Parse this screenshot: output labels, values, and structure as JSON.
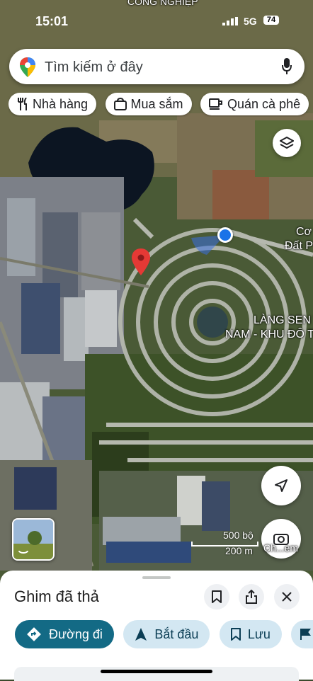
{
  "status_bar": {
    "time": "15:01",
    "network": "5G",
    "battery": "74",
    "top_label": "CÔNG NGHIỆP"
  },
  "search": {
    "placeholder": "Tìm kiếm ở đây"
  },
  "chips": [
    {
      "label": "Nhà hàng",
      "icon": "utensils-icon"
    },
    {
      "label": "Mua sắm",
      "icon": "shopping-bag-icon"
    },
    {
      "label": "Quán cà phê",
      "icon": "coffee-icon"
    }
  ],
  "map": {
    "labels": {
      "area_line1": "LÀNG SEN V",
      "area_line2": "NAM - KHU ĐÔ T",
      "edge_line1": "Cơ",
      "edge_line2": "Đất P"
    },
    "scale": {
      "feet": "500 bộ",
      "meters": "200 m"
    },
    "streetview_label": "Ch...em"
  },
  "sheet": {
    "title": "Ghim đã thả",
    "actions": [
      {
        "label": "Đường đi",
        "icon": "directions-icon"
      },
      {
        "label": "Bắt đầu",
        "icon": "navigation-arrow-icon"
      },
      {
        "label": "Lưu",
        "icon": "bookmark-icon"
      }
    ]
  },
  "colors": {
    "primary_action": "#136a85",
    "secondary_action": "#d3e7f2",
    "pin": "#e53935",
    "location_dot": "#1a73e8"
  }
}
